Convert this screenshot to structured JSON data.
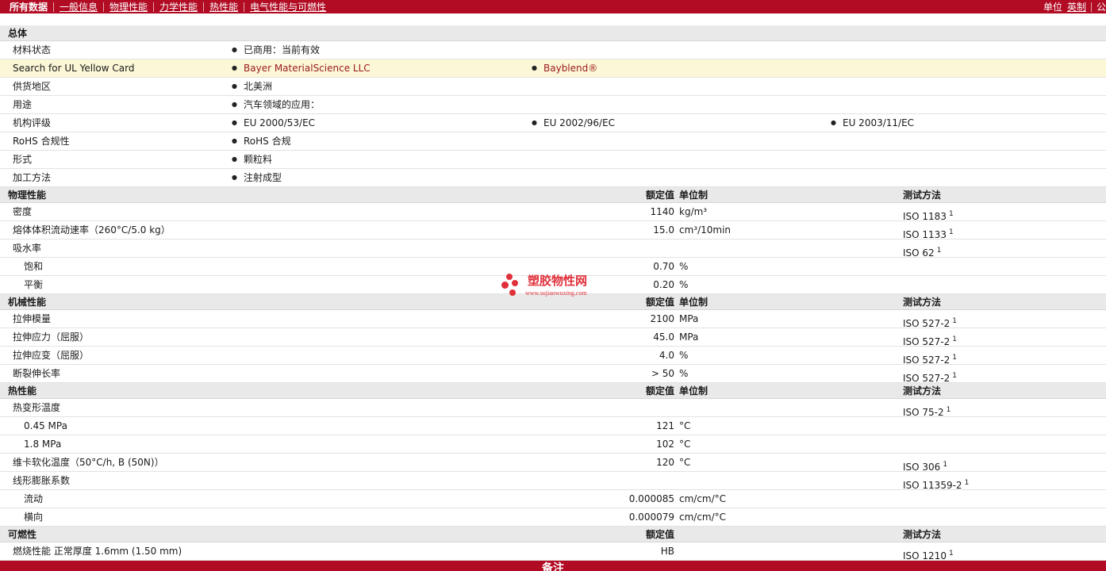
{
  "topbar": {
    "nav": [
      "所有数据",
      "一般信息",
      "物理性能",
      "力学性能",
      "热性能",
      "电气性能与可燃性"
    ],
    "units_label": "单位",
    "units_value": "英制",
    "units_next": "公"
  },
  "sections": {
    "general": {
      "title": "总体",
      "rows": [
        {
          "label": "材料状态",
          "items": [
            "已商用：当前有效"
          ]
        },
        {
          "label": "Search for UL Yellow Card",
          "items": [
            "Bayer MaterialScience LLC",
            "Bayblend®"
          ]
        },
        {
          "label": "供货地区",
          "items": [
            "北美洲"
          ]
        },
        {
          "label": "用途",
          "items": [
            "汽车领域的应用："
          ]
        },
        {
          "label": "机构评级",
          "items": [
            "EU 2000/53/EC",
            "EU 2002/96/EC",
            "EU 2003/11/EC"
          ]
        },
        {
          "label": "RoHS 合规性",
          "items": [
            "RoHS 合规"
          ]
        },
        {
          "label": "形式",
          "items": [
            "颗粒料"
          ]
        },
        {
          "label": "加工方法",
          "items": [
            "注射成型"
          ]
        }
      ]
    },
    "physical": {
      "title": "物理性能",
      "col_value": "额定值",
      "col_unit": "单位制",
      "col_method": "测试方法",
      "rows": [
        {
          "label": "密度",
          "value": "1140",
          "unit": "kg/m³",
          "method": "ISO 1183",
          "note": "1"
        },
        {
          "label": "熔体体积流动速率（260°C/5.0 kg）",
          "value": "15.0",
          "unit": "cm³/10min",
          "method": "ISO 1133",
          "note": "1"
        },
        {
          "label": "吸水率",
          "value": "",
          "unit": "",
          "method": "ISO 62",
          "note": "1"
        },
        {
          "label": "饱和",
          "value": "0.70",
          "unit": "%",
          "method": "",
          "note": ""
        },
        {
          "label": "平衡",
          "value": "0.20",
          "unit": "%",
          "method": "",
          "note": ""
        }
      ]
    },
    "mechanical": {
      "title": "机械性能",
      "col_value": "额定值",
      "col_unit": "单位制",
      "col_method": "测试方法",
      "rows": [
        {
          "label": "拉伸模量",
          "value": "2100",
          "unit": "MPa",
          "method": "ISO 527-2",
          "note": "1"
        },
        {
          "label": "拉伸应力（屈服）",
          "value": "45.0",
          "unit": "MPa",
          "method": "ISO 527-2",
          "note": "1"
        },
        {
          "label": "拉伸应变（屈服）",
          "value": "4.0",
          "unit": "%",
          "method": "ISO 527-2",
          "note": "1"
        },
        {
          "label": "断裂伸长率",
          "value": "> 50",
          "unit": "%",
          "method": "ISO 527-2",
          "note": "1"
        }
      ]
    },
    "thermal": {
      "title": "热性能",
      "col_value": "额定值",
      "col_unit": "单位制",
      "col_method": "测试方法",
      "rows": [
        {
          "label": "热变形温度",
          "value": "",
          "unit": "",
          "method": "ISO 75-2",
          "note": "1"
        },
        {
          "label": "0.45 MPa",
          "value": "121",
          "unit": "°C",
          "method": "",
          "note": ""
        },
        {
          "label": "1.8 MPa",
          "value": "102",
          "unit": "°C",
          "method": "",
          "note": ""
        },
        {
          "label": "维卡软化温度（50°C/h, B (50N)）",
          "value": "120",
          "unit": "°C",
          "method": "ISO 306",
          "note": "1"
        },
        {
          "label": "线形膨胀系数",
          "value": "",
          "unit": "",
          "method": "ISO 11359-2",
          "note": "1"
        },
        {
          "label": "流动",
          "value": "0.000085",
          "unit": "cm/cm/°C",
          "method": "",
          "note": ""
        },
        {
          "label": "横向",
          "value": "0.000079",
          "unit": "cm/cm/°C",
          "method": "",
          "note": ""
        }
      ]
    },
    "flammability": {
      "title": "可燃性",
      "col_value": "额定值",
      "col_method": "测试方法",
      "rows": [
        {
          "label": "燃烧性能  正常厚度  1.6mm (1.50 mm)",
          "value": "HB",
          "unit": "",
          "method": "ISO 1210",
          "note": "1"
        }
      ]
    }
  },
  "footer": {
    "label": "备注"
  },
  "watermark": {
    "title": "塑胶物性网",
    "url": "www.sujiaowuxing.com"
  },
  "colors": {
    "brand": "#b20c24",
    "highlight_row": "#fcf7d7",
    "link": "#9a1a1a",
    "watermark": "#e0303a"
  }
}
